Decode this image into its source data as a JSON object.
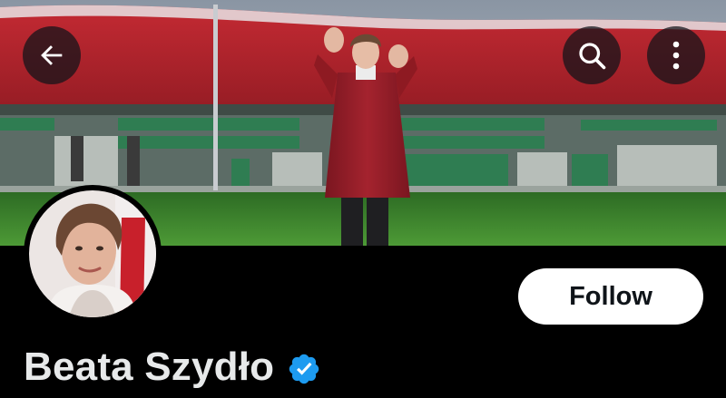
{
  "header": {
    "back_icon": "arrow-left-icon",
    "search_icon": "search-icon",
    "more_icon": "more-vertical-icon"
  },
  "banner": {
    "description_colors": {
      "flag_red": "#b01f2b",
      "pitch_green": "#3f8a2e",
      "seat_green": "#2e7a4f"
    }
  },
  "profile": {
    "name": "Beata Szydło",
    "verified_icon": "verified-badge-icon",
    "verified_color": "#1d9bf0",
    "follow_label": "Follow"
  }
}
